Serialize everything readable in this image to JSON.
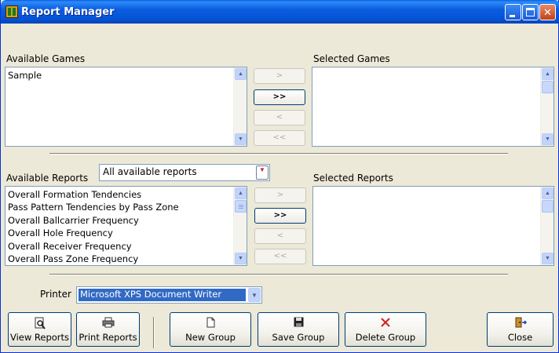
{
  "window": {
    "title": "Report Manager",
    "icon": "app-icon",
    "controls": {
      "minimize": "minimize-icon",
      "maximize": "maximize-icon",
      "close": "✕"
    }
  },
  "games": {
    "available_label": "Available Games",
    "selected_label": "Selected Games",
    "available_items": [
      "Sample"
    ],
    "selected_items": [],
    "buttons": {
      "add": ">",
      "add_all": ">>",
      "remove": "<",
      "remove_all": "<<"
    }
  },
  "reports": {
    "available_label": "Available Reports",
    "selected_label": "Selected Reports",
    "filter_value": "All available reports",
    "available_items": [
      "Overall Formation Tendencies",
      "Pass Pattern Tendencies by Pass Zone",
      "Overall Ballcarrier Frequency",
      "Overall Hole Frequency",
      "Overall Receiver Frequency",
      "Overall Pass Zone Frequency"
    ],
    "selected_items": [],
    "buttons": {
      "add": ">",
      "add_all": ">>",
      "remove": "<",
      "remove_all": "<<"
    }
  },
  "printer": {
    "label": "Printer",
    "value": "Microsoft XPS Document Writer"
  },
  "footer": {
    "view_reports": "View Reports",
    "print_reports": "Print Reports",
    "new_group": "New Group",
    "save_group": "Save Group",
    "delete_group": "Delete Group",
    "close": "Close"
  },
  "colors": {
    "titlebar": "#0553d6",
    "window_bg": "#ece9d8",
    "selection": "#316ac5",
    "delete_icon": "#d42020"
  }
}
